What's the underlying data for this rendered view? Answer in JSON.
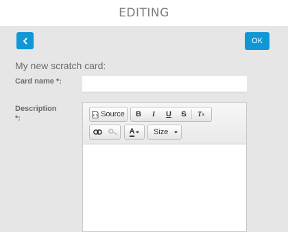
{
  "header": {
    "title": "EDITING"
  },
  "actions": {
    "back_icon": "chevron-left-icon",
    "ok_label": "OK"
  },
  "form": {
    "title": "My new scratch card:",
    "card_name": {
      "label": "Card name *:",
      "value": ""
    },
    "description": {
      "label_line1": "Description",
      "label_line2": "*:"
    }
  },
  "editor": {
    "toolbar": {
      "source_label": "Source",
      "bold_label": "B",
      "italic_label": "I",
      "underline_label": "U",
      "strike_label": "S",
      "clear_format_label": "T",
      "clear_format_sub": "x",
      "text_color_label": "A",
      "size_label": "Size"
    }
  },
  "colors": {
    "accent": "#0f97d6",
    "background": "#e6e6e6"
  }
}
